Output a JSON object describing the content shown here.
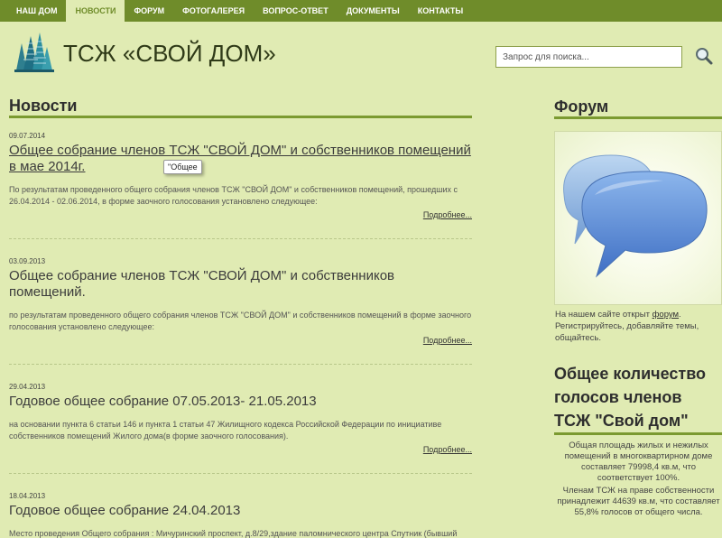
{
  "nav": {
    "items": [
      {
        "label": "НАШ ДОМ"
      },
      {
        "label": "НОВОСТИ"
      },
      {
        "label": "ФОРУМ"
      },
      {
        "label": "ФОТОГАЛЕРЕЯ"
      },
      {
        "label": "ВОПРОС-ОТВЕТ"
      },
      {
        "label": "ДОКУМЕНТЫ"
      },
      {
        "label": "КОНТАКТЫ"
      }
    ],
    "active_label": "НОВОСТИ"
  },
  "header": {
    "title": "ТСЖ «СВОЙ ДОМ»",
    "search_placeholder": "Запрос для поиска...",
    "logo_icon": "building-logo-icon",
    "search_icon": "magnifier-icon"
  },
  "news": {
    "heading": "Новости",
    "more_label": "Подробнее...",
    "tooltip": "\"Общее",
    "items": [
      {
        "date": "09.07.2014",
        "title": "Общее собрание членов ТСЖ \"СВОЙ ДОМ\" и собственников помещений в мае 2014г.",
        "excerpt": "По результатам проведенного общего собрания членов ТСЖ \"СВОЙ ДОМ\" и собственников помещений, прошедших с 26.04.2014 - 02.06.2014, в форме заочного голосования установлено следующее:"
      },
      {
        "date": "03.09.2013",
        "title": "Общее собрание членов ТСЖ \"СВОЙ ДОМ\" и собственников помещений.",
        "excerpt": "по результатам проведенного общего собрания членов ТСЖ \"СВОЙ ДОМ\" и собственников помещений в форме заочного голосования установлено следующее:"
      },
      {
        "date": "29.04.2013",
        "title": "Годовое общее собрание 07.05.2013- 21.05.2013",
        "excerpt": "на основании пункта 6 статьи 146 и пункта 1 статьи 47 Жилищного кодекса Российской Федерации по инициативе собственников помещений Жилого дома(в форме заочного голосования)."
      },
      {
        "date": "18.04.2013",
        "title": "Годовое общее собрание 24.04.2013",
        "excerpt": "Место проведения Общего собрания : Мичуринский проспект, д.8/29,здание паломнического центра Спутник (бывший кинотеатр Литва) возле гостиницы Университетская, остановка общественного"
      }
    ]
  },
  "sidebar": {
    "forum_heading": "Форум",
    "forum_image_icon": "speech-bubbles-icon",
    "forum_text_before": "На нашем сайте открыт ",
    "forum_link": "форум",
    "forum_text_after": ". Регистрируйтесь, добавляйте темы, общайтесь.",
    "votes_heading": "Общее количество голосов членов ТСЖ \"Свой дом\"",
    "votes_text_1": "Общая площадь жилых и нежилых помещений в многоквартирном доме составляет 79998,4 кв.м, что соответствует 100%.",
    "votes_text_2": "Членам ТСЖ на праве собственности принадлежит 44639 кв.м, что составляет 55,8% голосов от общего числа."
  },
  "colors": {
    "nav_bg": "#6f8c2a",
    "page_bg": "#e0ebb3",
    "accent_rule": "#7b9a30"
  }
}
